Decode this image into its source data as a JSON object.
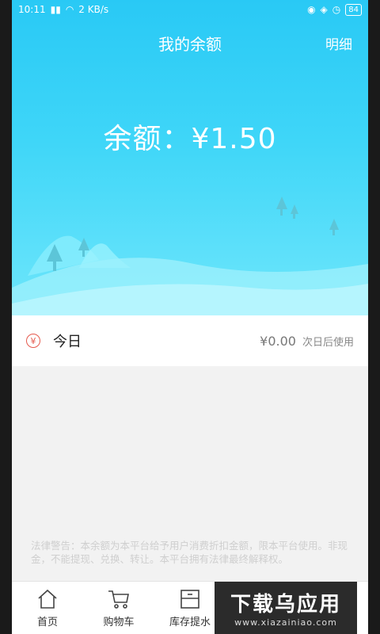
{
  "status": {
    "time": "10:11",
    "network": "2 KB/s",
    "battery": "84"
  },
  "header": {
    "title": "我的余额",
    "detail_link": "明细"
  },
  "balance": {
    "text": "余额：¥1.50"
  },
  "today": {
    "icon_char": "¥",
    "label": "今日",
    "amount": "¥0.00",
    "note": "次日后使用"
  },
  "legal": {
    "text": "法律警告：本余额为本平台给予用户消费折扣金额，限本平台使用。非现金，不能提现、兑换、转让。本平台拥有法律最终解释权。"
  },
  "tabbar": {
    "items": [
      {
        "label": "首页",
        "icon": "home-icon"
      },
      {
        "label": "购物车",
        "icon": "cart-icon"
      },
      {
        "label": "库存提水",
        "icon": "box-icon"
      },
      {
        "label": "",
        "icon": "hidden"
      },
      {
        "label": "",
        "icon": "hidden"
      }
    ]
  },
  "watermark": {
    "main": "下载乌应用",
    "sub": "www.xiazainiao.com"
  },
  "colors": {
    "hero_top": "#29c9f5",
    "hero_bottom": "#6ee6fb",
    "accent_red": "#e55a4e"
  }
}
